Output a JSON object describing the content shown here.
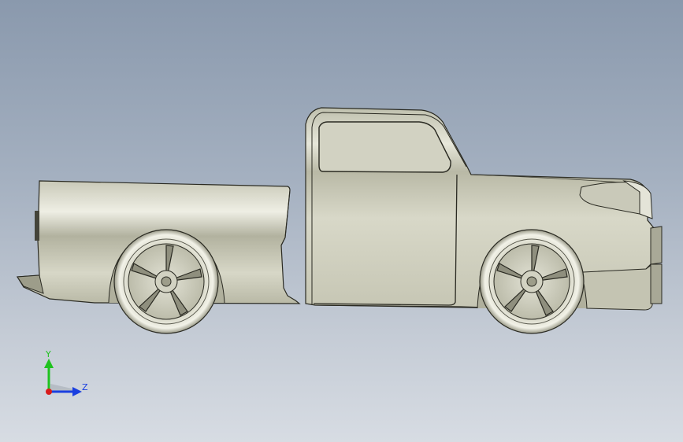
{
  "view": {
    "model": "pickup-truck",
    "orientation": "side"
  },
  "triad": {
    "y_label": "Y",
    "z_label": "Z",
    "y_color": "#1fc21f",
    "z_color": "#1a3fe0",
    "x_color": "#d81b1b"
  }
}
